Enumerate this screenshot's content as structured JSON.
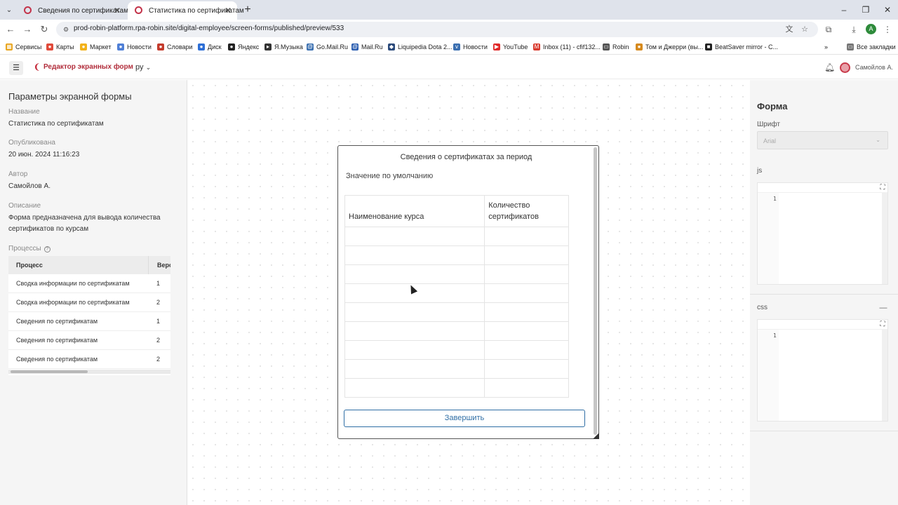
{
  "browser": {
    "tabs": [
      {
        "title": "Сведения по сертификатам",
        "active": false
      },
      {
        "title": "Статистика по сертификатам",
        "active": true
      }
    ],
    "url": "prod-robin-platform.rpa-robin.site/digital-employee/screen-forms/published/preview/533",
    "profile_letter": "A",
    "bookmarks": [
      {
        "label": "Сервисы",
        "icon": "apps-grid-icon",
        "color": "#e8a41c"
      },
      {
        "label": "Карты",
        "icon": "map-pin-icon",
        "color": "#e04a3a"
      },
      {
        "label": "Маркет",
        "icon": "market-icon",
        "color": "#f2b21a"
      },
      {
        "label": "Новости",
        "icon": "news-icon",
        "color": "#4f7fd6"
      },
      {
        "label": "Словари",
        "icon": "dictionary-icon",
        "color": "#c43b2c"
      },
      {
        "label": "Диск",
        "icon": "disk-icon",
        "color": "#2e6fd6"
      },
      {
        "label": "Яндекс",
        "icon": "yandex-icon",
        "color": "#222222"
      },
      {
        "label": "Я.Музыка",
        "icon": "music-icon",
        "color": "#333333"
      },
      {
        "label": "Go.Mail.Ru",
        "icon": "search-icon",
        "color": "#3a6fb0"
      },
      {
        "label": "Mail.Ru",
        "icon": "mail-icon",
        "color": "#2a5db0"
      },
      {
        "label": "Liquipedia Dota 2...",
        "icon": "liquipedia-icon",
        "color": "#2b4a7a"
      },
      {
        "label": "Новости",
        "icon": "vk-icon",
        "color": "#3b6fb0"
      },
      {
        "label": "YouTube",
        "icon": "youtube-icon",
        "color": "#e02a2a"
      },
      {
        "label": "Inbox (11) - cfif132...",
        "icon": "gmail-icon",
        "color": "#d93b2f"
      },
      {
        "label": "Robin",
        "icon": "folder-icon",
        "color": "#555555"
      },
      {
        "label": "Том и Джерри (вы...",
        "icon": "tom-jerry-icon",
        "color": "#d68a1e"
      },
      {
        "label": "BeatSaver mirror - C...",
        "icon": "beatsaver-icon",
        "color": "#222222"
      }
    ],
    "all_bookmarks": "Все закладки"
  },
  "header": {
    "brand": "Редактор экранных форм",
    "lang": "ру",
    "username": "Самойлов А."
  },
  "left": {
    "title": "Параметры экранной формы",
    "name_label": "Название",
    "name_value": "Статистика по сертификатам",
    "published_label": "Опубликована",
    "published_value": "20 июн. 2024 11:16:23",
    "author_label": "Автор",
    "author_value": "Самойлов А.",
    "desc_label": "Описание",
    "desc_value": "Форма предназначена для вывода количества сертификатов по курсам",
    "processes_label": "Процессы",
    "table": {
      "col_process": "Процесс",
      "col_version": "Версия",
      "rows": [
        {
          "process": "Сводка информации по сертификатам",
          "version": "1"
        },
        {
          "process": "Сводка информации по сертификатам",
          "version": "2"
        },
        {
          "process": "Сведения по сертификатам",
          "version": "1"
        },
        {
          "process": "Сведения по сертификатам",
          "version": "2"
        },
        {
          "process": "Сведения по сертификатам",
          "version": "2"
        }
      ]
    }
  },
  "form": {
    "title": "Сведения о сертификатах за период",
    "default_text": "Значение по умолчанию",
    "col_course": "Наименование курса",
    "col_count": "Количество сертификатов",
    "empty_rows": 9,
    "finish_button": "Завершить"
  },
  "right": {
    "title": "Форма",
    "font_label": "Шрифт",
    "font_value": "Arial",
    "js_label": "js",
    "js_line": "1",
    "css_label": "css",
    "css_line": "1"
  },
  "colors": {
    "brand": "#b12c3a",
    "button": "#2f6ea5"
  }
}
